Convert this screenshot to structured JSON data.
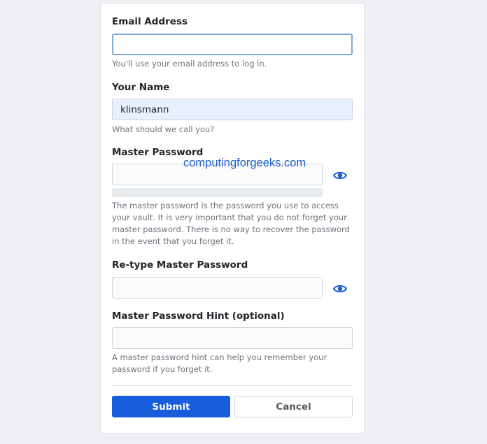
{
  "form": {
    "email": {
      "label": "Email Address",
      "value": "",
      "help": "You'll use your email address to log in."
    },
    "name": {
      "label": "Your Name",
      "value": "klinsmann",
      "help": "What should we call you?"
    },
    "master_password": {
      "label": "Master Password",
      "value": "",
      "help": "The master password is the password you use to access your vault. It is very important that you do not forget your master password. There is no way to recover the password in the event that you forget it.",
      "toggle_icon": "eye-icon"
    },
    "retype_password": {
      "label": "Re-type Master Password",
      "value": "",
      "toggle_icon": "eye-icon"
    },
    "hint": {
      "label": "Master Password Hint (optional)",
      "value": "",
      "help": "A master password hint can help you remember your password if you forget it."
    },
    "buttons": {
      "submit_label": "Submit",
      "cancel_label": "Cancel"
    }
  },
  "watermark": "computingforgeeks.com",
  "colors": {
    "primary": "#175ddc",
    "background": "#eef0f3",
    "autofill": "#e8f0fe",
    "focus_border": "#80a8d9"
  }
}
